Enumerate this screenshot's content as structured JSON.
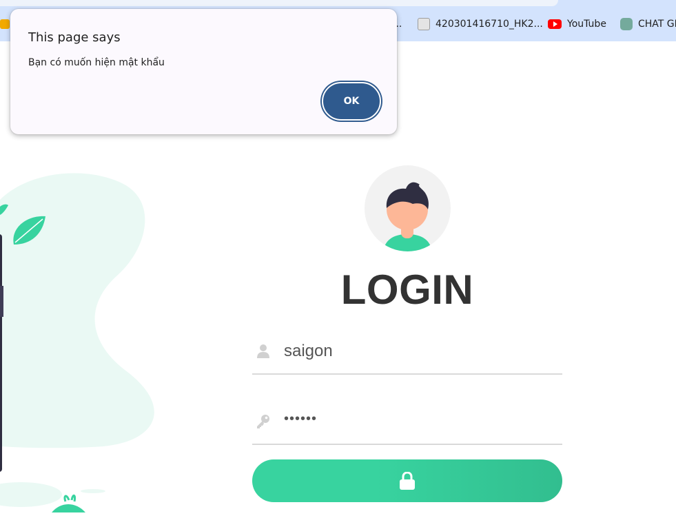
{
  "browser": {
    "bookmarks": [
      {
        "label": "...",
        "icon": "document-icon"
      },
      {
        "label": "420301416710_HK2...",
        "icon": "document-icon"
      },
      {
        "label": "YouTube",
        "icon": "youtube-icon"
      },
      {
        "label": "CHAT GPT",
        "icon": "chatgpt-icon"
      }
    ]
  },
  "dialog": {
    "title": "This page says",
    "message": "Bạn có muốn hiện mật khẩu",
    "ok_label": "OK"
  },
  "login": {
    "title": "LOGIN",
    "username_value": "saigon",
    "password_value": "••••••",
    "submit_icon": "lock-icon"
  },
  "colors": {
    "accent": "#38d39f",
    "dialog_button": "#2f5a8e",
    "title_text": "#333333",
    "bookmark_bar": "#d3e3fd"
  }
}
